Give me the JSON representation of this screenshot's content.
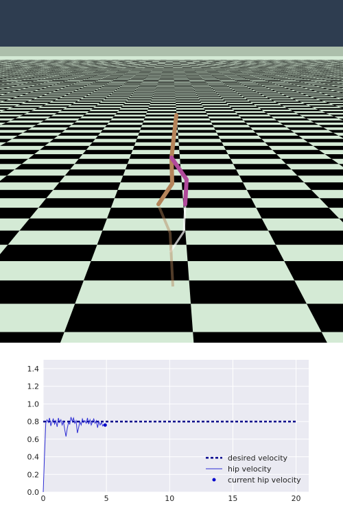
{
  "scene": {
    "sky_color": "#2e3d50",
    "floor_light_color": "#d4ead5",
    "floor_dark_color": "#000000",
    "left_leg_color": "#b5845a",
    "right_leg_color": "#b04a9a",
    "reflection_color": "#ffffff"
  },
  "chart_data": {
    "type": "line",
    "xlim": [
      0,
      21
    ],
    "ylim": [
      0,
      1.5
    ],
    "xticks": [
      "0",
      "5",
      "10",
      "15",
      "20"
    ],
    "yticks": [
      "0.0",
      "0.2",
      "0.4",
      "0.6",
      "0.8",
      "1.0",
      "1.2",
      "1.4"
    ],
    "grid": true,
    "legend_placement": "bottom-right",
    "background_color": "#eaeaf2",
    "series": [
      {
        "name": "desired velocity",
        "style": "dashed",
        "color": "#00008b",
        "x": [
          0,
          20
        ],
        "y": [
          0.8,
          0.8
        ]
      },
      {
        "name": "hip velocity",
        "style": "solid",
        "color": "#2b2bd4",
        "x": [
          0,
          0.1,
          0.2,
          0.3,
          0.4,
          0.5,
          0.6,
          0.7,
          0.8,
          0.9,
          1.0,
          1.1,
          1.2,
          1.3,
          1.4,
          1.5,
          1.6,
          1.7,
          1.8,
          1.9,
          2.0,
          2.1,
          2.2,
          2.3,
          2.4,
          2.5,
          2.6,
          2.7,
          2.8,
          2.9,
          3.0,
          3.1,
          3.2,
          3.3,
          3.4,
          3.5,
          3.6,
          3.7,
          3.8,
          3.9,
          4.0,
          4.1,
          4.2,
          4.3,
          4.4,
          4.5,
          4.6,
          4.7,
          4.8,
          4.9
        ],
        "y": [
          0.0,
          0.4,
          0.78,
          0.82,
          0.79,
          0.84,
          0.75,
          0.8,
          0.83,
          0.77,
          0.81,
          0.74,
          0.84,
          0.79,
          0.82,
          0.76,
          0.8,
          0.71,
          0.63,
          0.72,
          0.79,
          0.77,
          0.85,
          0.8,
          0.84,
          0.78,
          0.81,
          0.67,
          0.73,
          0.8,
          0.76,
          0.83,
          0.79,
          0.81,
          0.78,
          0.84,
          0.77,
          0.82,
          0.76,
          0.8,
          0.83,
          0.78,
          0.81,
          0.73,
          0.8,
          0.76,
          0.79,
          0.75,
          0.77,
          0.76
        ]
      },
      {
        "name": "current hip velocity",
        "style": "point",
        "color": "#0000cc",
        "x": [
          4.9
        ],
        "y": [
          0.76
        ]
      }
    ]
  }
}
